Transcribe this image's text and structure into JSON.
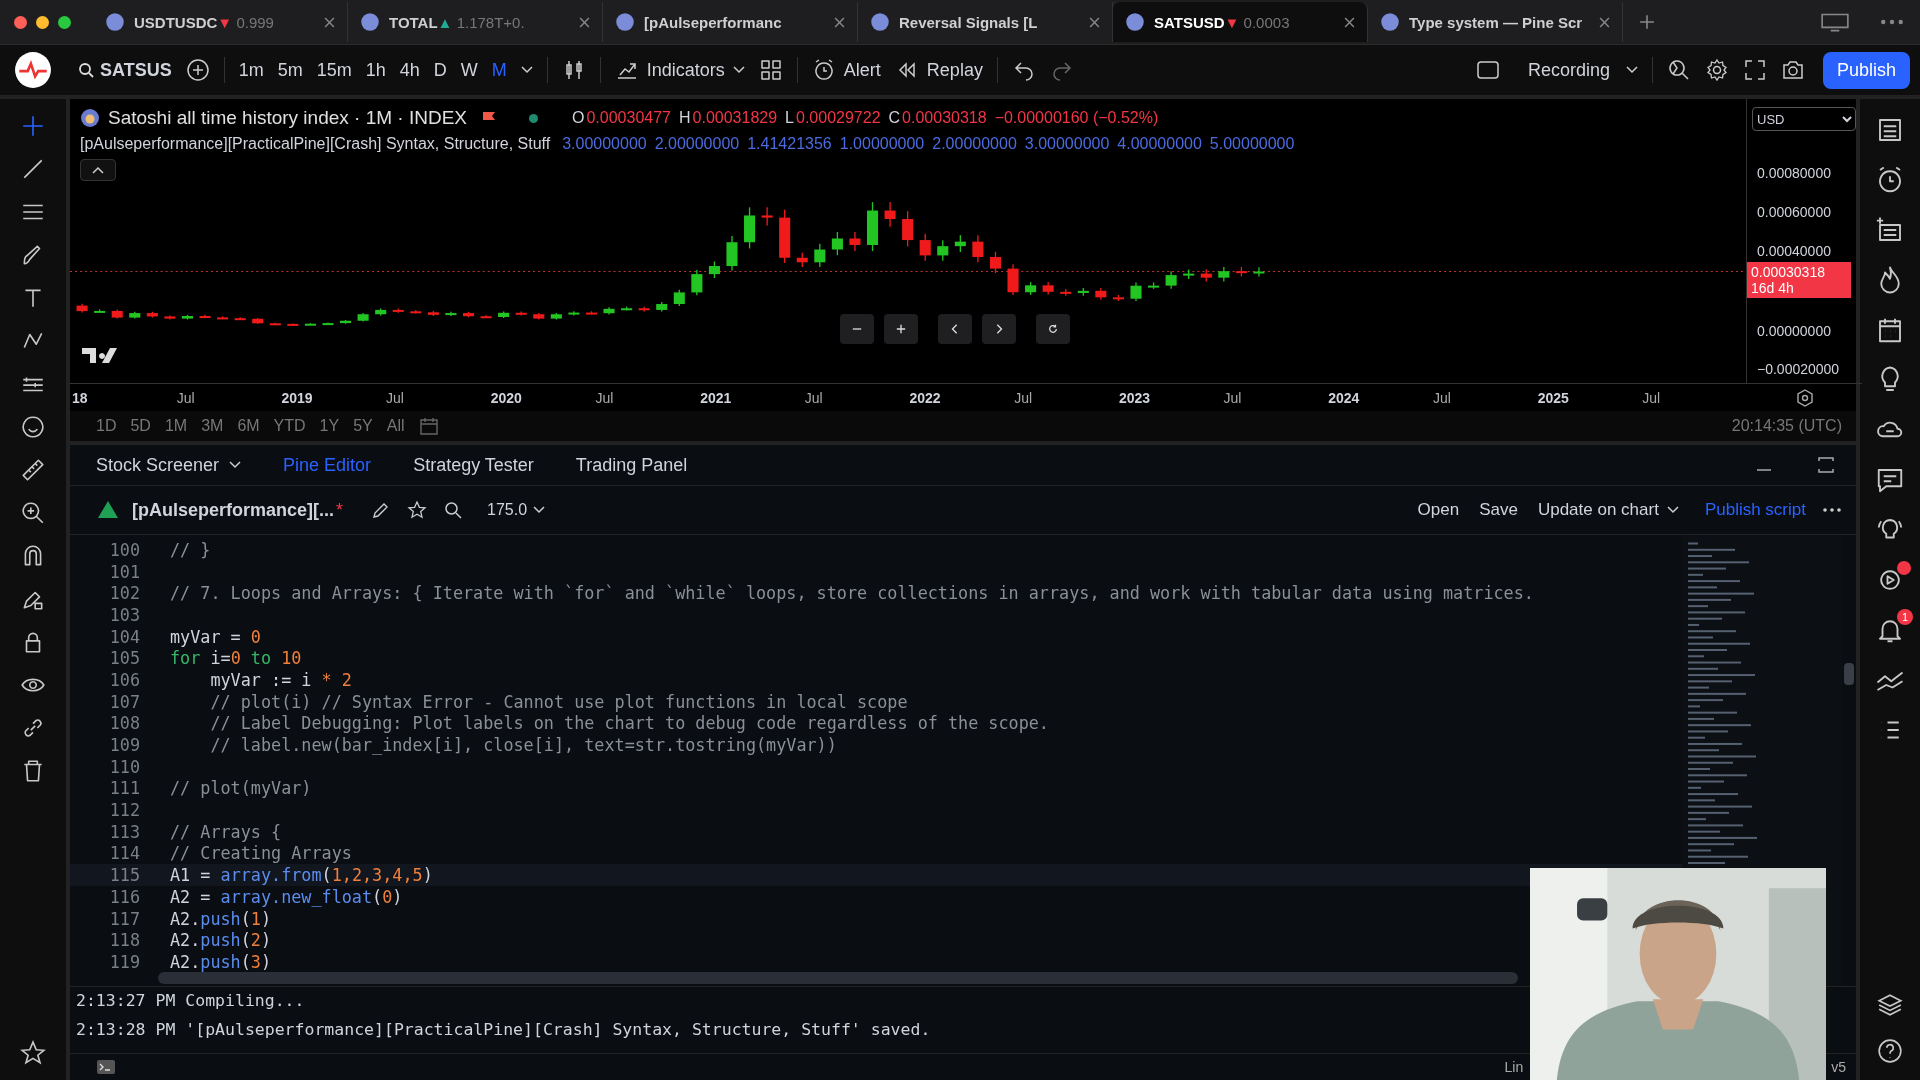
{
  "browser_tabs": [
    {
      "name": "USDTUSDC",
      "rising": false,
      "arrow": "▼",
      "value": "0.999",
      "selected": false
    },
    {
      "name": "TOTAL",
      "rising": true,
      "arrow": "▲",
      "value": "1.178T",
      "extra": "+0.",
      "selected": false
    },
    {
      "name": "[pAulseperformanc",
      "selected": false
    },
    {
      "name": "Reversal Signals [L",
      "selected": false
    },
    {
      "name": "SATSUSD",
      "rising": false,
      "arrow": "▼",
      "value": "0.0003",
      "selected": true
    },
    {
      "name": "Type system — Pine Scr",
      "selected": false
    }
  ],
  "toolbar": {
    "symbol": "SATSUS",
    "intervals": [
      {
        "label": "1m",
        "selected": false
      },
      {
        "label": "5m",
        "selected": false
      },
      {
        "label": "15m",
        "selected": false
      },
      {
        "label": "1h",
        "selected": false
      },
      {
        "label": "4h",
        "selected": false
      },
      {
        "label": "D",
        "selected": false
      },
      {
        "label": "W",
        "selected": false
      },
      {
        "label": "M",
        "selected": true
      }
    ],
    "indicators": "Indicators",
    "alert": "Alert",
    "replay": "Replay",
    "recording": "Recording",
    "publish": "Publish"
  },
  "chart": {
    "title": "Satoshi all time history index · 1M · INDEX",
    "ohlc": [
      {
        "key": "O",
        "value": "0.00030477"
      },
      {
        "key": "H",
        "value": "0.00031829"
      },
      {
        "key": "L",
        "value": "0.00029722"
      },
      {
        "key": "C",
        "value": "0.00030318"
      }
    ],
    "change": "−0.00000160 (−0.52%)",
    "indicator_name": "[pAulseperformance][PracticalPine][Crash] Syntax, Structure, Stuff",
    "indicator_values": [
      "3.00000000",
      "2.00000000",
      "1.41421356",
      "1.00000000",
      "2.00000000",
      "3.00000000",
      "4.00000000",
      "5.00000000"
    ],
    "currency": "USD",
    "price_labels": [
      "0.00080000",
      "0.00060000",
      "0.00040000",
      "0.00000000",
      "−0.00020000"
    ],
    "last_price": "0.00030318",
    "countdown": "16d 4h",
    "time_labels": [
      {
        "label": "18",
        "bold": true
      },
      {
        "label": "Jul",
        "bold": false
      },
      {
        "label": "2019",
        "bold": true
      },
      {
        "label": "Jul",
        "bold": false
      },
      {
        "label": "2020",
        "bold": true
      },
      {
        "label": "Jul",
        "bold": false
      },
      {
        "label": "2021",
        "bold": true
      },
      {
        "label": "Jul",
        "bold": false
      },
      {
        "label": "2022",
        "bold": true
      },
      {
        "label": "Jul",
        "bold": false
      },
      {
        "label": "2023",
        "bold": true
      },
      {
        "label": "Jul",
        "bold": false
      },
      {
        "label": "2024",
        "bold": true
      },
      {
        "label": "Jul",
        "bold": false
      },
      {
        "label": "2025",
        "bold": true
      },
      {
        "label": "Jul",
        "bold": false
      }
    ],
    "ranges": [
      "1D",
      "5D",
      "1M",
      "3M",
      "6M",
      "YTD",
      "1Y",
      "5Y",
      "All"
    ],
    "clock": "20:14:35 (UTC)"
  },
  "panel_tabs": [
    {
      "label": "Stock Screener",
      "selected": false,
      "caret": true
    },
    {
      "label": "Pine Editor",
      "selected": true,
      "caret": false
    },
    {
      "label": "Strategy Tester",
      "selected": false,
      "caret": false
    },
    {
      "label": "Trading Panel",
      "selected": false,
      "caret": false
    }
  ],
  "editor": {
    "script_name": "[pAulseperformance][...",
    "unsaved": true,
    "version": "175.0",
    "actions": [
      "Open",
      "Save",
      "Update on chart"
    ],
    "publish": "Publish script",
    "lines": [
      {
        "num": "100",
        "selected": false,
        "tokens": [
          {
            "t": "// }",
            "kind": "comment"
          }
        ]
      },
      {
        "num": "101",
        "selected": false
      },
      {
        "num": "102",
        "selected": false,
        "tokens": [
          {
            "t": "// 7. Loops and Arrays: { Iterate with `for` and `while` loops, store collections in arrays, and work with tabular data using matrices.",
            "kind": "comment"
          }
        ]
      },
      {
        "num": "103",
        "selected": false
      },
      {
        "num": "104",
        "selected": false,
        "tokens": [
          {
            "t": "myVar = ",
            "kind": "plain"
          },
          {
            "t": "0",
            "kind": "number"
          }
        ]
      },
      {
        "num": "105",
        "selected": false,
        "tokens": [
          {
            "t": "for",
            "kind": "keyword"
          },
          {
            "t": " i=",
            "kind": "plain"
          },
          {
            "t": "0",
            "kind": "number"
          },
          {
            "t": " to ",
            "kind": "keyword"
          },
          {
            "t": "10",
            "kind": "number"
          }
        ]
      },
      {
        "num": "106",
        "selected": false,
        "tokens": [
          {
            "t": "    myVar := i ",
            "kind": "plain"
          },
          {
            "t": "*",
            "kind": "number"
          },
          {
            "t": " 2",
            "kind": "number"
          }
        ]
      },
      {
        "num": "107",
        "selected": false,
        "tokens": [
          {
            "t": "    // plot(i) // Syntax Error - Cannot use plot functions in local scope",
            "kind": "comment"
          }
        ]
      },
      {
        "num": "108",
        "selected": false,
        "tokens": [
          {
            "t": "    // Label Debugging: Plot labels on the chart to debug code regardless of the scope.",
            "kind": "comment"
          }
        ]
      },
      {
        "num": "109",
        "selected": false,
        "tokens": [
          {
            "t": "    // label.new(bar_index[i], close[i], text=str.tostring(myVar))",
            "kind": "comment"
          }
        ]
      },
      {
        "num": "110",
        "selected": false
      },
      {
        "num": "111",
        "selected": false,
        "tokens": [
          {
            "t": "// plot(myVar)",
            "kind": "comment"
          }
        ]
      },
      {
        "num": "112",
        "selected": false
      },
      {
        "num": "113",
        "selected": false,
        "tokens": [
          {
            "t": "// Arrays {",
            "kind": "comment"
          }
        ]
      },
      {
        "num": "114",
        "selected": false,
        "tokens": [
          {
            "t": "// Creating Arrays",
            "kind": "comment"
          }
        ]
      },
      {
        "num": "115",
        "selected": true,
        "tokens": [
          {
            "t": "A1 = ",
            "kind": "plain"
          },
          {
            "t": "array.from",
            "kind": "func"
          },
          {
            "t": "(",
            "kind": "plain"
          },
          {
            "t": "1,2,3,4,5",
            "kind": "number"
          },
          {
            "t": ")",
            "kind": "plain"
          }
        ]
      },
      {
        "num": "116",
        "selected": false,
        "tokens": [
          {
            "t": "A2 = ",
            "kind": "plain"
          },
          {
            "t": "array.new_float",
            "kind": "func"
          },
          {
            "t": "(",
            "kind": "plain"
          },
          {
            "t": "0",
            "kind": "number"
          },
          {
            "t": ")",
            "kind": "plain"
          }
        ]
      },
      {
        "num": "117",
        "selected": false,
        "tokens": [
          {
            "t": "A2.",
            "kind": "plain"
          },
          {
            "t": "push",
            "kind": "func"
          },
          {
            "t": "(",
            "kind": "plain"
          },
          {
            "t": "1",
            "kind": "number"
          },
          {
            "t": ")",
            "kind": "plain"
          }
        ]
      },
      {
        "num": "118",
        "selected": false,
        "tokens": [
          {
            "t": "A2.",
            "kind": "plain"
          },
          {
            "t": "push",
            "kind": "func"
          },
          {
            "t": "(",
            "kind": "plain"
          },
          {
            "t": "2",
            "kind": "number"
          },
          {
            "t": ")",
            "kind": "plain"
          }
        ]
      },
      {
        "num": "119",
        "selected": false,
        "tokens": [
          {
            "t": "A2.",
            "kind": "plain"
          },
          {
            "t": "push",
            "kind": "func"
          },
          {
            "t": "(",
            "kind": "plain"
          },
          {
            "t": "3",
            "kind": "number"
          },
          {
            "t": ")",
            "kind": "plain"
          }
        ]
      }
    ]
  },
  "console": [
    "2:13:27 PM Compiling...",
    "2:13:28 PM '[pAulseperformance][PracticalPine][Crash] Syntax, Structure, Stuff' saved."
  ],
  "status_bar": {
    "position": "Lin",
    "version": "v5"
  },
  "notifications": {
    "badge": "1"
  },
  "webcam": {
    "kind": "picture"
  }
}
